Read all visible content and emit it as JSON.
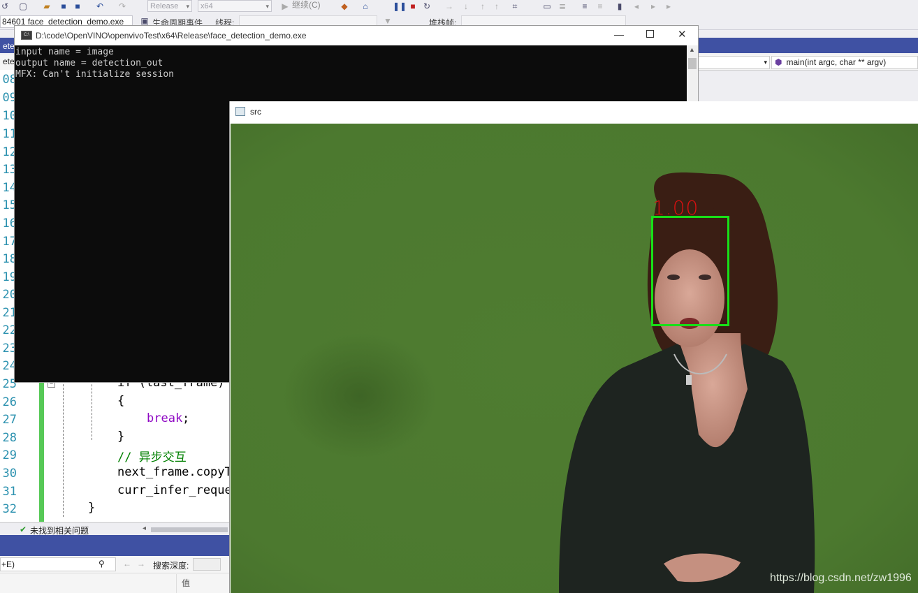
{
  "vs": {
    "toolbar": {
      "config_combo": "Release",
      "platform_combo": "x64",
      "continue_label": "继续(C)"
    },
    "toolbar2": {
      "process_combo": "84601 face_detection_demo.exe",
      "lifecycle_label": "生命周期事件",
      "thread_label": "线程:",
      "stackframe_label": "堆栈帧:"
    },
    "tabstrip": {
      "active_tab": "etec"
    },
    "navbar": {
      "scope_combo": "ete",
      "function_combo": "main(int argc, char ** argv)"
    },
    "editor": {
      "line_numbers": [
        "08",
        "09",
        "10",
        "11",
        "12",
        "13",
        "14",
        "15",
        "16",
        "17",
        "18",
        "19",
        "20",
        "21",
        "22",
        "23",
        "24",
        "25",
        "26",
        "27",
        "28",
        "29",
        "30",
        "31",
        "32"
      ],
      "visible_code": {
        "l25": "if (last_frame)",
        "l26": "{",
        "l27_kw": "break",
        "l27_rest": ";",
        "l28": "}",
        "l29": "// 异步交互",
        "l30": "next_frame.copyT",
        "l31": "curr_infer_reque",
        "l32": "}"
      }
    },
    "status": {
      "issues": "未找到相关问题"
    },
    "bottom": {
      "search_hint": "+E)",
      "search_depth_label": "搜索深度:",
      "value_col": "值"
    }
  },
  "console": {
    "title": "D:\\code\\OpenVINO\\openvivoTest\\x64\\Release\\face_detection_demo.exe",
    "lines": [
      "input name = image",
      "output name = detection_out",
      "MFX: Can't initialize session"
    ]
  },
  "src_window": {
    "title": "src",
    "detection_score": "1.00",
    "watermark": "https://blog.csdn.net/zw1996"
  },
  "colors": {
    "vs_blue": "#3f51a3",
    "console_bg": "#0c0c0c",
    "green_screen": "#4d7a30",
    "bbox": "#18e018",
    "score_text": "#dd1010"
  }
}
